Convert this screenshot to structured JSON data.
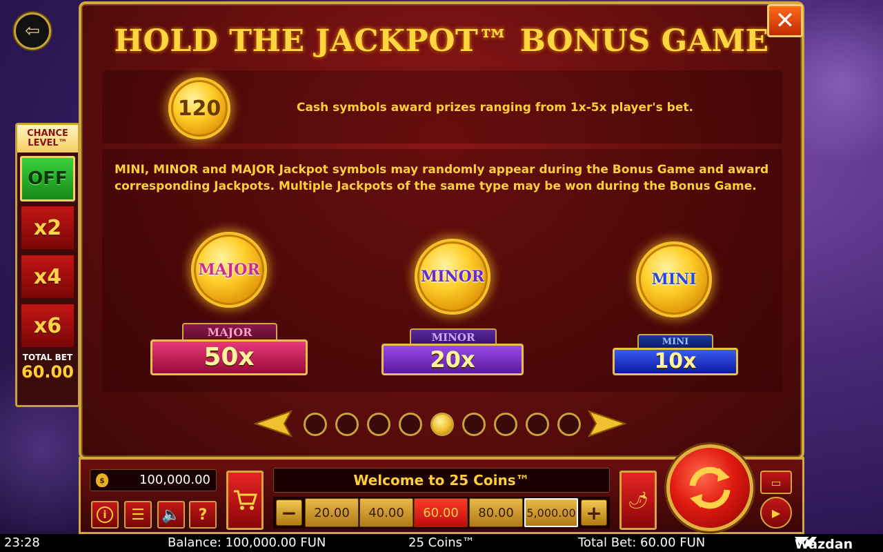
{
  "title": "HOLD THE JACKPOT™ BONUS GAME",
  "side_panel": {
    "title_line1": "CHANCE",
    "title_line2": "LEVEL™",
    "options": [
      "OFF",
      "x2",
      "x4",
      "x6"
    ],
    "selected": "OFF",
    "total_bet_label": "TOTAL BET",
    "total_bet_value": "60.00"
  },
  "cash": {
    "coin_value": "120",
    "description": "Cash symbols award prizes ranging from 1x-5x player's bet."
  },
  "jackpots": {
    "description": "MINI, MINOR and MAJOR Jackpot symbols may randomly appear during the Bonus Game and award corresponding Jackpots. Multiple Jackpots of the same type may be won during the Bonus Game.",
    "items": [
      {
        "coin_label": "MAJOR",
        "tag": "MAJOR",
        "multiplier": "50x",
        "color": "#d02a8c"
      },
      {
        "coin_label": "MINOR",
        "tag": "MINOR",
        "multiplier": "20x",
        "color": "#6a2ac8"
      },
      {
        "coin_label": "MINI",
        "tag": "MINI",
        "multiplier": "10x",
        "color": "#2a4ad0"
      }
    ]
  },
  "pager": {
    "pages": 9,
    "current": 5
  },
  "bottom": {
    "balance": "100,000.00",
    "welcome": "Welcome to 25 Coins™",
    "bet_options": [
      "20.00",
      "40.00",
      "60.00",
      "80.00",
      "5,000.00"
    ],
    "selected_bet": "60.00",
    "minus": "−",
    "plus": "+"
  },
  "status": {
    "time": "23:28",
    "balance": "Balance: 100,000.00 FUN",
    "game": "25 Coins™",
    "total_bet": "Total Bet: 60.00 FUN",
    "brand": "Wazdan"
  },
  "icons": {
    "exit": "exit-icon",
    "close": "close-icon",
    "info": "info-icon",
    "menu": "menu-icon",
    "sound": "sound-icon",
    "help": "help-icon",
    "cart": "cart-icon",
    "turbo": "chili-icon",
    "spin": "spin-icon",
    "autoplay": "autoplay-icon"
  }
}
